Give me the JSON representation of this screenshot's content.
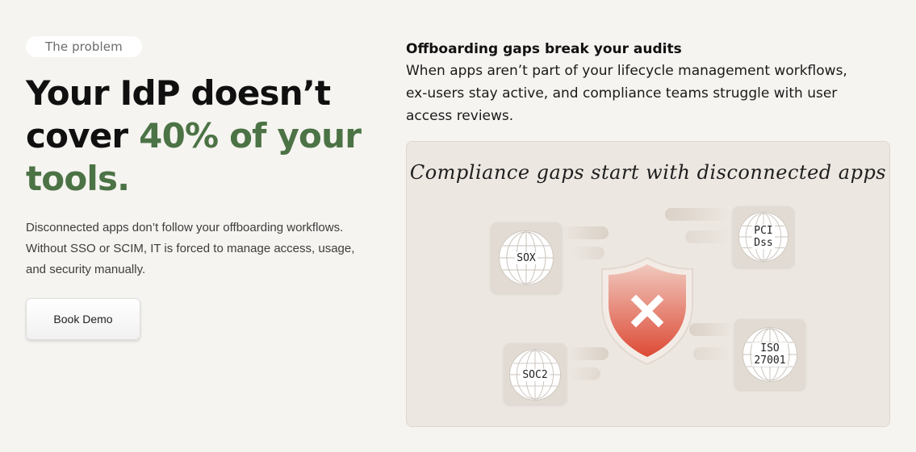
{
  "intro": {
    "pill": "The problem",
    "headline_part1": "Your IdP doesn’t cover ",
    "headline_accent": "40% of your tools.",
    "body": "Disconnected apps don’t follow your offboarding workflows. Without SSO or SCIM, IT is forced to manage access, usage, and security manually.",
    "button": "Book Demo"
  },
  "audit": {
    "title": "Offboarding gaps break your audits",
    "description": "When apps aren’t part of your lifecycle management workflows, ex-users stay active, and compliance teams struggle with user access reviews."
  },
  "illustration": {
    "caption": "Compliance gaps start with disconnected apps",
    "badges": {
      "sox": "SOX",
      "pci": "PCI\nDss",
      "soc2": "SOC2",
      "iso": "ISO\n27001"
    },
    "shield_icon": "x-mark-icon",
    "colors": {
      "accent_green": "#4c7346",
      "shield_red": "#e05a45",
      "card_bg": "#ece7e1"
    }
  }
}
